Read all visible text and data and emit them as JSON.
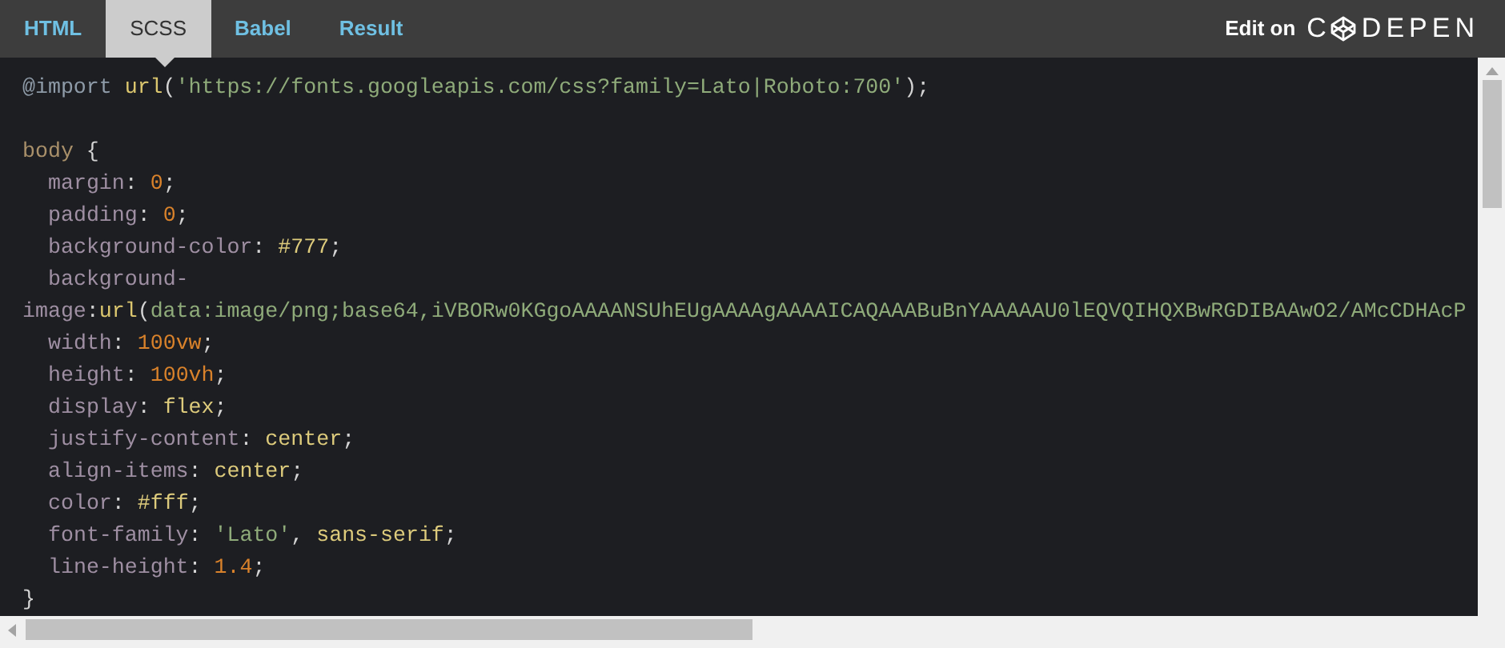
{
  "tabs": [
    {
      "label": "HTML",
      "selected": false
    },
    {
      "label": "SCSS",
      "selected": true
    },
    {
      "label": "Babel",
      "selected": false
    },
    {
      "label": "Result",
      "selected": false
    }
  ],
  "edit_link": {
    "label": "Edit on",
    "logo_start": "C",
    "logo_end": "DEPEN"
  },
  "code_lines": [
    {
      "kind": "code",
      "indent": false,
      "tokens": [
        {
          "kind": "at-rule",
          "text": "@import "
        },
        {
          "kind": "function",
          "text": "url"
        },
        {
          "kind": "punct",
          "text": "("
        },
        {
          "kind": "string",
          "text": "'https://fonts.googleapis.com/css?family=Lato|Roboto:700'"
        },
        {
          "kind": "punct",
          "text": ");"
        }
      ]
    },
    {
      "kind": "blank"
    },
    {
      "kind": "code",
      "indent": false,
      "tokens": [
        {
          "kind": "selector",
          "text": "body"
        },
        {
          "kind": "punct",
          "text": " {"
        }
      ]
    },
    {
      "kind": "code",
      "indent": true,
      "tokens": [
        {
          "kind": "property",
          "text": "margin"
        },
        {
          "kind": "punct",
          "text": ": "
        },
        {
          "kind": "number",
          "text": "0"
        },
        {
          "kind": "punct",
          "text": ";"
        }
      ]
    },
    {
      "kind": "code",
      "indent": true,
      "tokens": [
        {
          "kind": "property",
          "text": "padding"
        },
        {
          "kind": "punct",
          "text": ": "
        },
        {
          "kind": "number",
          "text": "0"
        },
        {
          "kind": "punct",
          "text": ";"
        }
      ]
    },
    {
      "kind": "code",
      "indent": true,
      "tokens": [
        {
          "kind": "property",
          "text": "background-color"
        },
        {
          "kind": "punct",
          "text": ": "
        },
        {
          "kind": "keyword",
          "text": "#777"
        },
        {
          "kind": "punct",
          "text": ";"
        }
      ]
    },
    {
      "kind": "code",
      "indent": true,
      "tokens": [
        {
          "kind": "property",
          "text": "background-"
        }
      ]
    },
    {
      "kind": "code",
      "indent": false,
      "tokens": [
        {
          "kind": "property",
          "text": "image"
        },
        {
          "kind": "punct",
          "text": ":"
        },
        {
          "kind": "function",
          "text": "url"
        },
        {
          "kind": "punct",
          "text": "("
        },
        {
          "kind": "string",
          "text": "data:image/png;base64,iVBORw0KGgoAAAANSUhEUgAAAAgAAAAICAQAAABuBnYAAAAAU0lEQVQIHQXBwRGDIBAAwO2/AMcCDHAcP"
        }
      ]
    },
    {
      "kind": "code",
      "indent": true,
      "tokens": [
        {
          "kind": "property",
          "text": "width"
        },
        {
          "kind": "punct",
          "text": ": "
        },
        {
          "kind": "number",
          "text": "100vw"
        },
        {
          "kind": "punct",
          "text": ";"
        }
      ]
    },
    {
      "kind": "code",
      "indent": true,
      "tokens": [
        {
          "kind": "property",
          "text": "height"
        },
        {
          "kind": "punct",
          "text": ": "
        },
        {
          "kind": "number",
          "text": "100vh"
        },
        {
          "kind": "punct",
          "text": ";"
        }
      ]
    },
    {
      "kind": "code",
      "indent": true,
      "tokens": [
        {
          "kind": "property",
          "text": "display"
        },
        {
          "kind": "punct",
          "text": ": "
        },
        {
          "kind": "keyword",
          "text": "flex"
        },
        {
          "kind": "punct",
          "text": ";"
        }
      ]
    },
    {
      "kind": "code",
      "indent": true,
      "tokens": [
        {
          "kind": "property",
          "text": "justify-content"
        },
        {
          "kind": "punct",
          "text": ": "
        },
        {
          "kind": "keyword",
          "text": "center"
        },
        {
          "kind": "punct",
          "text": ";"
        }
      ]
    },
    {
      "kind": "code",
      "indent": true,
      "tokens": [
        {
          "kind": "property",
          "text": "align-items"
        },
        {
          "kind": "punct",
          "text": ": "
        },
        {
          "kind": "keyword",
          "text": "center"
        },
        {
          "kind": "punct",
          "text": ";"
        }
      ]
    },
    {
      "kind": "code",
      "indent": true,
      "tokens": [
        {
          "kind": "property",
          "text": "color"
        },
        {
          "kind": "punct",
          "text": ": "
        },
        {
          "kind": "keyword",
          "text": "#fff"
        },
        {
          "kind": "punct",
          "text": ";"
        }
      ]
    },
    {
      "kind": "code",
      "indent": true,
      "tokens": [
        {
          "kind": "property",
          "text": "font-family"
        },
        {
          "kind": "punct",
          "text": ": "
        },
        {
          "kind": "string",
          "text": "'Lato'"
        },
        {
          "kind": "punct",
          "text": ", "
        },
        {
          "kind": "keyword",
          "text": "sans-serif"
        },
        {
          "kind": "punct",
          "text": ";"
        }
      ]
    },
    {
      "kind": "code",
      "indent": true,
      "tokens": [
        {
          "kind": "property",
          "text": "line-height"
        },
        {
          "kind": "punct",
          "text": ": "
        },
        {
          "kind": "number",
          "text": "1.4"
        },
        {
          "kind": "punct",
          "text": ";"
        }
      ]
    },
    {
      "kind": "code",
      "indent": false,
      "tokens": [
        {
          "kind": "punct",
          "text": "}"
        }
      ]
    }
  ]
}
